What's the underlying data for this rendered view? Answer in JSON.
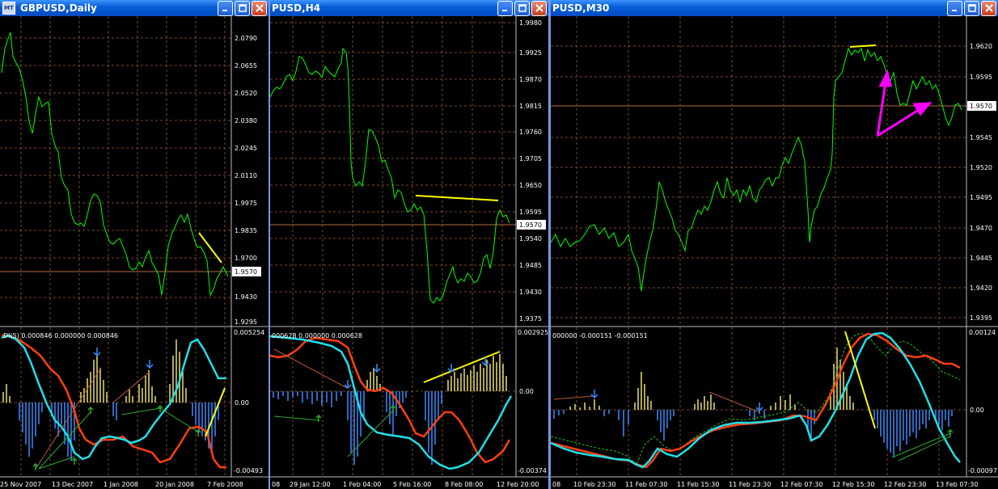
{
  "windows": [
    {
      "title": "GBPUSD,Daily",
      "price_axis": [
        "2.0790",
        "2.0655",
        "2.0520",
        "2.0380",
        "2.0245",
        "2.0110",
        "1.9975",
        "1.9835",
        "1.9700",
        "1.9570",
        "1.9430",
        "1.9295"
      ],
      "current_price": "1.9570",
      "indicator_label": "DI(5) 0.000846 0.000000 0.000846",
      "indicator_axis": [
        "0.005254",
        "0.00",
        "-0.00493"
      ],
      "time_axis": [
        "25 Nov 2007",
        "13 Dec 2007",
        "1 Jan 2008",
        "20 Jan 2008",
        "7 Feb 2008"
      ]
    },
    {
      "title": "PUSD,H4",
      "price_axis": [
        "1.9980",
        "1.9925",
        "1.9870",
        "1.9815",
        "1.9760",
        "1.9705",
        "1.9650",
        "1.9595",
        "1.9540",
        "1.9485",
        "1.9430",
        "1.9375"
      ],
      "current_price": "1.9570",
      "indicator_label": "000628 0.000000 0.000628",
      "indicator_axis": [
        "0.002925",
        "0.00",
        "-0.00374"
      ],
      "time_axis": [
        "08",
        "29 Jan 12:00",
        "1 Feb 04:00",
        "5 Feb 16:00",
        "8 Feb 08:00",
        "12 Feb 20:00"
      ]
    },
    {
      "title": "PUSD,M30",
      "price_axis": [
        "1.9620",
        "1.9595",
        "1.9570",
        "1.9545",
        "1.9520",
        "1.9495",
        "1.9470",
        "1.9445",
        "1.9420",
        "1.9395"
      ],
      "current_price": "1.9570",
      "indicator_label": "000000 -0.000151 -0.000151",
      "indicator_axis": [
        "0.00124",
        "0.00",
        "-0.00097"
      ],
      "time_axis": [
        "08",
        "10 Feb 23:30",
        "11 Feb 07:30",
        "11 Feb 15:30",
        "11 Feb 23:30",
        "12 Feb 07:30",
        "12 Feb 15:30",
        "12 Feb 23:30",
        "13 Feb 07:30"
      ]
    }
  ],
  "colors": {
    "background": "#000000",
    "grid": "#7a4a2a",
    "price_line": "#00ff00",
    "current_price_line": "#b86a3a",
    "trendline": "#ffff00",
    "annotation_arrow": "#ff00ff",
    "osc_fast": "#ff4010",
    "osc_slow": "#20e0e8",
    "hist_pos": "#e8e070",
    "hist_neg": "#3a8cff"
  },
  "icons": [
    "chart-icon",
    "minimize-icon",
    "maximize-icon",
    "close-icon"
  ]
}
